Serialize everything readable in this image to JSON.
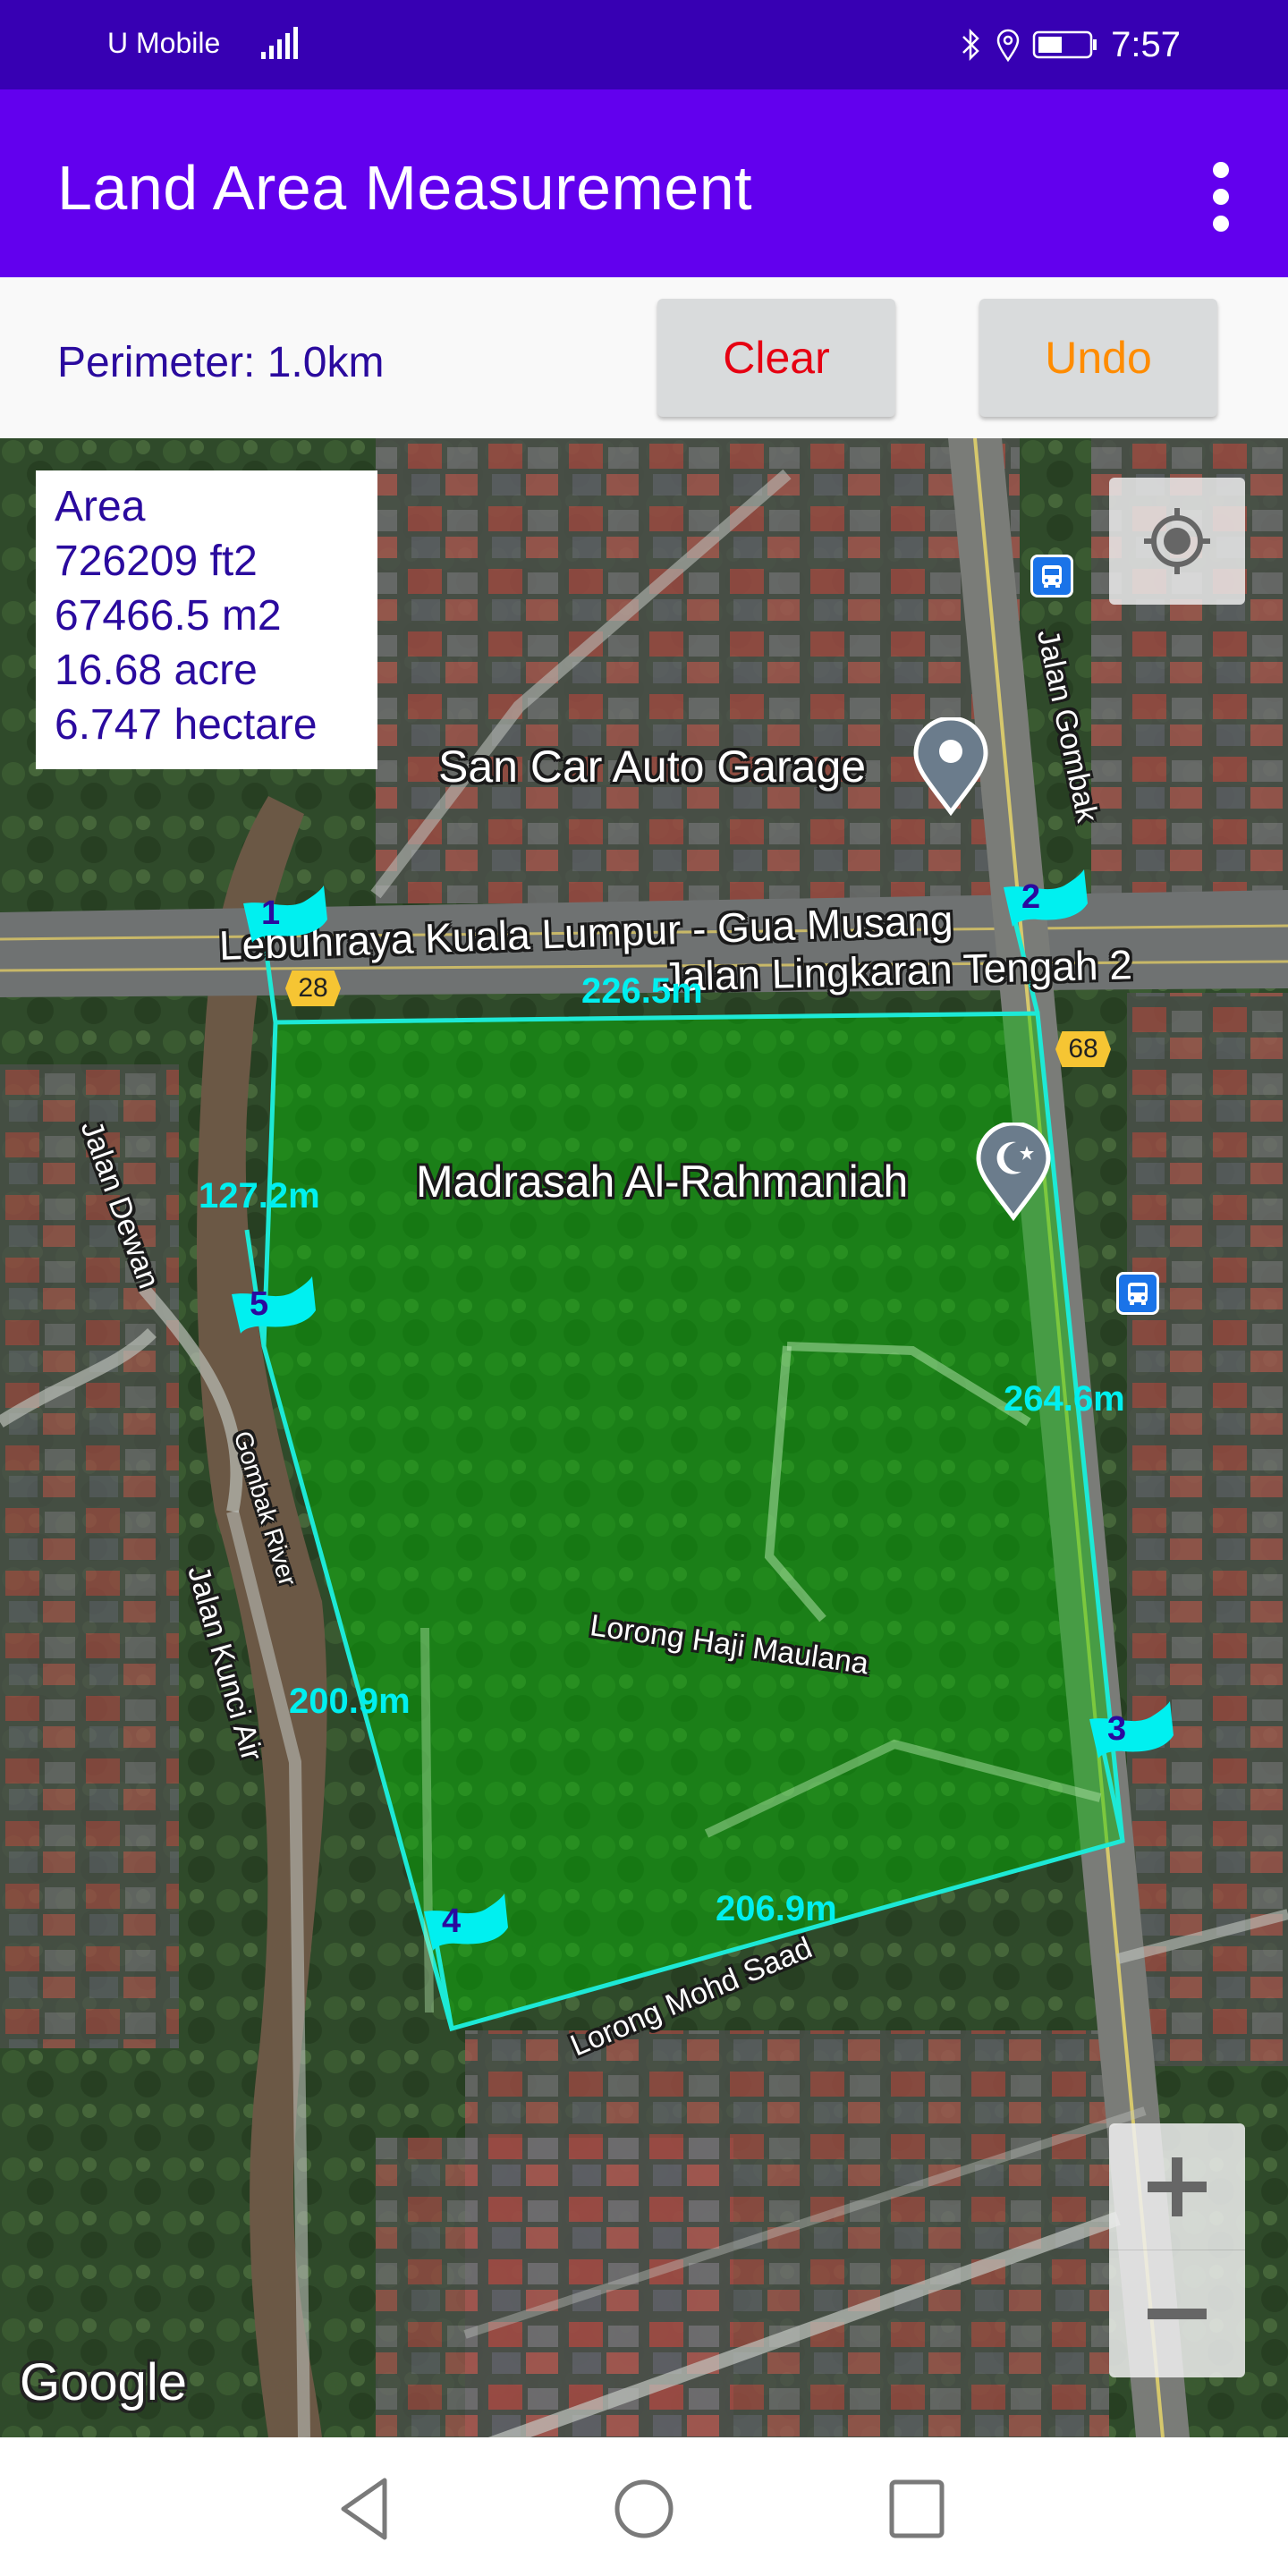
{
  "status_bar": {
    "carrier": "U Mobile",
    "time": "7:57",
    "icons": [
      "signal-icon",
      "bluetooth-icon",
      "location-icon",
      "battery-icon"
    ]
  },
  "app_bar": {
    "title": "Land Area Measurement",
    "menu_icon": "more-vert-icon"
  },
  "toolbar": {
    "perimeter": "Perimeter: 1.0km",
    "clear_label": "Clear",
    "undo_label": "Undo",
    "clear_color": "#e60012",
    "undo_color": "#ff8c00"
  },
  "area_panel": {
    "lines": [
      "Area",
      "726209 ft2",
      "67466.5 m2",
      "16.68 acre",
      "6.747 hectare"
    ]
  },
  "map": {
    "vertices": [
      {
        "label": "1"
      },
      {
        "label": "2"
      },
      {
        "label": "3"
      },
      {
        "label": "4"
      },
      {
        "label": "5"
      }
    ],
    "segment_lengths": [
      "226.5m",
      "264.6m",
      "206.9m",
      "200.9m",
      "127.2m"
    ],
    "places": {
      "garage": "San Car Auto Garage",
      "madrasah": "Madrasah Al-Rahmaniah"
    },
    "roads": {
      "highway": "Lebuhraya Kuala Lumpur - Gua Musang",
      "mrr2": "Jalan Lingkaran Tengah 2",
      "gombak": "Jalan Gombak",
      "dewan": "Jalan Dewan",
      "river": "Gombak River",
      "kunci_air": "Jalan Kunci Air",
      "haji_maulana": "Lorong Haji Maulana",
      "mohd_saad": "Lorong Mohd Saad"
    },
    "route_numbers": [
      "28",
      "68"
    ],
    "attribution": "Google",
    "polygon_stroke": "#1de9d6",
    "polygon_fill": "#00c800"
  },
  "nav_bar": {
    "buttons": [
      "back",
      "home",
      "recents"
    ]
  }
}
